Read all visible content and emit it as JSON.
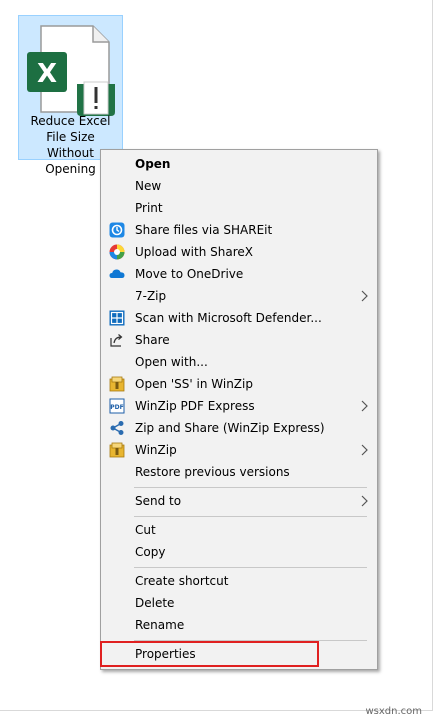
{
  "desktop": {
    "file_label": "Reduce Excel File Size Without Opening",
    "file_icon": "excel-file-icon"
  },
  "context_menu": {
    "items": [
      {
        "label": "Open",
        "bold": true,
        "icon": null,
        "submenu": false
      },
      {
        "label": "New",
        "bold": false,
        "icon": null,
        "submenu": false
      },
      {
        "label": "Print",
        "bold": false,
        "icon": null,
        "submenu": false
      },
      {
        "label": "Share files via SHAREit",
        "bold": false,
        "icon": "shareit-icon",
        "submenu": false
      },
      {
        "label": "Upload with ShareX",
        "bold": false,
        "icon": "sharex-icon",
        "submenu": false
      },
      {
        "label": "Move to OneDrive",
        "bold": false,
        "icon": "onedrive-icon",
        "submenu": false
      },
      {
        "label": "7-Zip",
        "bold": false,
        "icon": null,
        "submenu": true
      },
      {
        "label": "Scan with Microsoft Defender...",
        "bold": false,
        "icon": "defender-icon",
        "submenu": false
      },
      {
        "label": "Share",
        "bold": false,
        "icon": "share-icon",
        "submenu": false
      },
      {
        "label": "Open with...",
        "bold": false,
        "icon": null,
        "submenu": false
      },
      {
        "label": "Open 'SS' in WinZip",
        "bold": false,
        "icon": "winzip-icon",
        "submenu": false
      },
      {
        "label": "WinZip PDF Express",
        "bold": false,
        "icon": "winzip-pdf-icon",
        "submenu": true
      },
      {
        "label": "Zip and Share (WinZip Express)",
        "bold": false,
        "icon": "zip-share-icon",
        "submenu": false
      },
      {
        "label": "WinZip",
        "bold": false,
        "icon": "winzip-icon",
        "submenu": true
      },
      {
        "label": "Restore previous versions",
        "bold": false,
        "icon": null,
        "submenu": false
      },
      {
        "label": "Send to",
        "bold": false,
        "icon": null,
        "submenu": true
      },
      {
        "label": "Cut",
        "bold": false,
        "icon": null,
        "submenu": false
      },
      {
        "label": "Copy",
        "bold": false,
        "icon": null,
        "submenu": false
      },
      {
        "label": "Create shortcut",
        "bold": false,
        "icon": null,
        "submenu": false
      },
      {
        "label": "Delete",
        "bold": false,
        "icon": null,
        "submenu": false
      },
      {
        "label": "Rename",
        "bold": false,
        "icon": null,
        "submenu": false
      },
      {
        "label": "Properties",
        "bold": false,
        "icon": null,
        "submenu": false
      }
    ],
    "highlighted_item": "Properties"
  },
  "colors": {
    "selection_bg": "#cce8ff",
    "menu_bg": "#f2f2f2",
    "highlight_border": "#e02020",
    "excel_green": "#1d6f42"
  },
  "watermark": "wsxdn.com"
}
